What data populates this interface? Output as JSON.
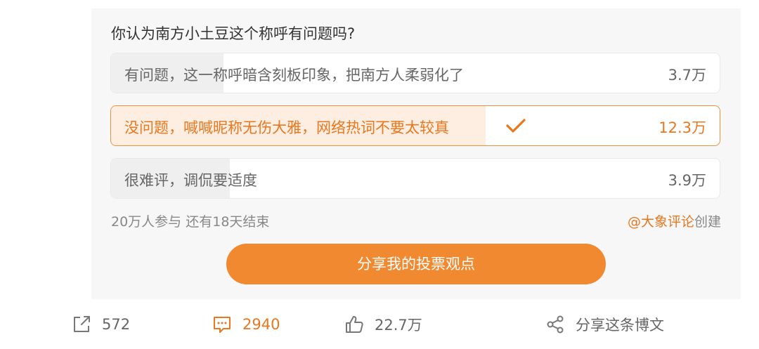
{
  "poll": {
    "question": "你认为南方小土豆这个称呼有问题吗?",
    "options": [
      {
        "label": "有问题，这一称呼暗含刻板印象，把南方人柔弱化了",
        "count": "3.7万",
        "fraction": 0.185,
        "selected": false
      },
      {
        "label": "没问题，喊喊昵称无伤大雅，网络热词不要太较真",
        "count": "12.3万",
        "fraction": 0.615,
        "selected": true
      },
      {
        "label": "很难评，调侃要适度",
        "count": "3.9万",
        "fraction": 0.195,
        "selected": false
      }
    ],
    "participants": "20万人参与",
    "remaining": "还有18天结束",
    "creator": "@大象评论",
    "created_suffix": "创建",
    "share_button": "分享我的投票观点"
  },
  "actions": {
    "repost_count": "572",
    "comment_count": "2940",
    "like_count": "22.7万",
    "share_label": "分享这条博文"
  },
  "icons": {
    "check": "check-icon",
    "repost": "repost-icon",
    "comment": "comment-icon",
    "like": "thumbs-up-icon",
    "share": "share-nodes-icon"
  },
  "colors": {
    "accent": "#f0892f",
    "accent_text": "#e8771f",
    "selected_fill": "#fdeee1",
    "option_fill": "#efefef",
    "card_bg": "#f7f7f7"
  }
}
